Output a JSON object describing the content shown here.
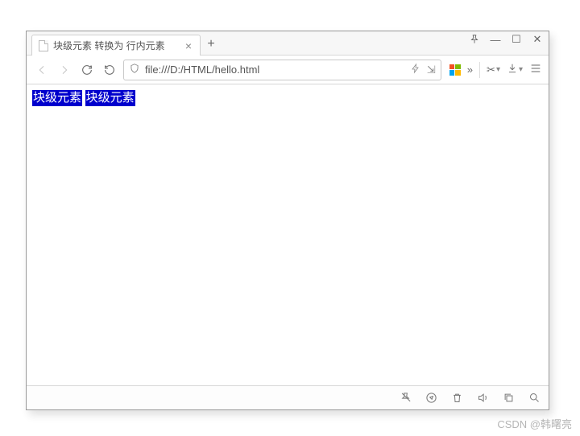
{
  "window": {
    "pin_icon": "pin-icon",
    "minimize": "—",
    "maximize": "☐",
    "close": "✕"
  },
  "tab": {
    "title": "块级元素 转换为 行内元素",
    "close": "×"
  },
  "newtab": "+",
  "toolbar": {
    "url": "file:///D:/HTML/hello.html",
    "lightning": "⚡",
    "expand_glyph": "⇲",
    "more": "»",
    "scissors": "✂",
    "download": "↓",
    "menu": "≡"
  },
  "content": {
    "span1": "块级元素",
    "span2": "块级元素"
  },
  "statusbar": {
    "icons": [
      "pin",
      "compass",
      "trash",
      "volume",
      "copy",
      "search"
    ]
  },
  "watermark": "CSDN @韩曙亮"
}
